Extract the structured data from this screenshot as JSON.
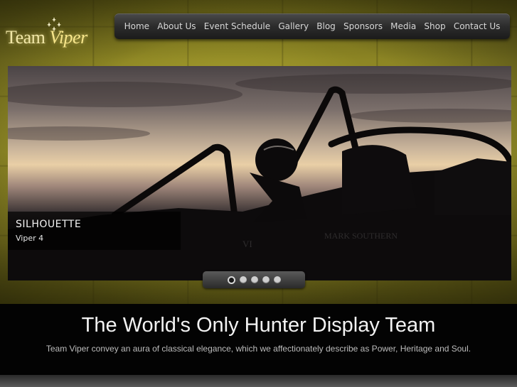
{
  "logo": {
    "text_part1": "Team",
    "text_part2": "Viper"
  },
  "nav": {
    "items": [
      {
        "label": "Home"
      },
      {
        "label": "About Us"
      },
      {
        "label": "Event Schedule"
      },
      {
        "label": "Gallery"
      },
      {
        "label": "Blog"
      },
      {
        "label": "Sponsors"
      },
      {
        "label": "Media"
      },
      {
        "label": "Shop"
      },
      {
        "label": "Contact Us"
      }
    ]
  },
  "slider": {
    "caption_title": "SILHOUETTE",
    "caption_subtitle": "Viper 4",
    "image_text": "MARK SOUTHERN",
    "image_text_left": "VI",
    "slide_count": 5,
    "active_slide": 1
  },
  "band": {
    "headline": "The World's Only Hunter Display Team",
    "tagline": "Team Viper convey an aura of classical elegance, which we affectionately describe as Power, Heritage and Soul."
  },
  "colors": {
    "background_olive": "#9d962b",
    "nav_dark": "#2c2c2c",
    "band": "#030303"
  }
}
